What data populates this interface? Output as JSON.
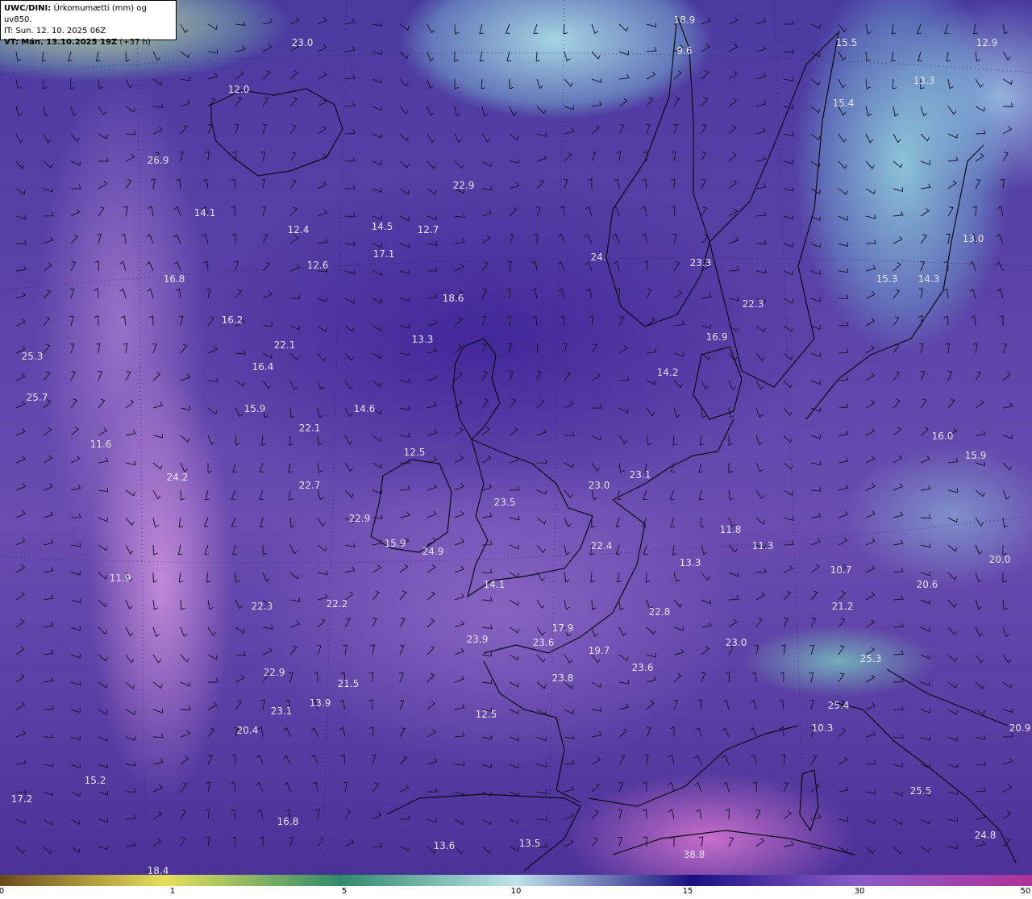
{
  "header": {
    "model": "UWC/DINI:",
    "product": "Úrkomumætti (mm) og uv850.",
    "it_prefix": "IT:",
    "init_time": "Sun. 12. 10. 2025 06Z",
    "vt_prefix": "VT:",
    "valid_time": "Mán. 13.10.2025 19Z",
    "lead": "(+37 h)"
  },
  "colors": {
    "low": "#6b4a1a",
    "accent": "#e6e05a",
    "teal": "#2f8a6a",
    "pale": "#bfe3ea",
    "navy": "#1a1080",
    "violet": "#8a5cc8",
    "magenta": "#b0309a",
    "label": "#e6e2f2"
  },
  "legend": {
    "ticks": [
      "0",
      "1",
      "5",
      "10",
      "15",
      "30",
      "50"
    ]
  },
  "values": [
    "18.9",
    "9.6",
    "15.5",
    "12.9",
    "23.0",
    "13.3",
    "12.0",
    "15.4",
    "26.9",
    "22.9",
    "14.1",
    "14.5",
    "12.7",
    "12.4",
    "17.1",
    "12.6",
    "24.",
    "23.3",
    "15.3",
    "14.3",
    "13.0",
    "16.8",
    "18.6",
    "22.3",
    "16.2",
    "13.3",
    "16.9",
    "22.1",
    "16.4",
    "14.2",
    "25.3",
    "25.7",
    "15.9",
    "14.6",
    "22.1",
    "16.0",
    "15.9",
    "11.6",
    "12.5",
    "24.2",
    "22.7",
    "23.0",
    "23.1",
    "23.5",
    "22.9",
    "11.8",
    "11.3",
    "15.9",
    "24.9",
    "22.4",
    "13.3",
    "20.0",
    "11.9",
    "14.1",
    "10.7",
    "20.6",
    "22.3",
    "22.2",
    "21.2",
    "22.8",
    "17.9",
    "23.9",
    "23.6",
    "19.7",
    "23.0",
    "22.9",
    "23.6",
    "23.8",
    "25.3",
    "21.5",
    "13.9",
    "23.1",
    "12.5",
    "25.4",
    "20.4",
    "10.3",
    "20.9",
    "15.2",
    "17.2",
    "16.8",
    "25.5",
    "13.6",
    "13.5",
    "24.8",
    "18.4",
    "38.8"
  ]
}
